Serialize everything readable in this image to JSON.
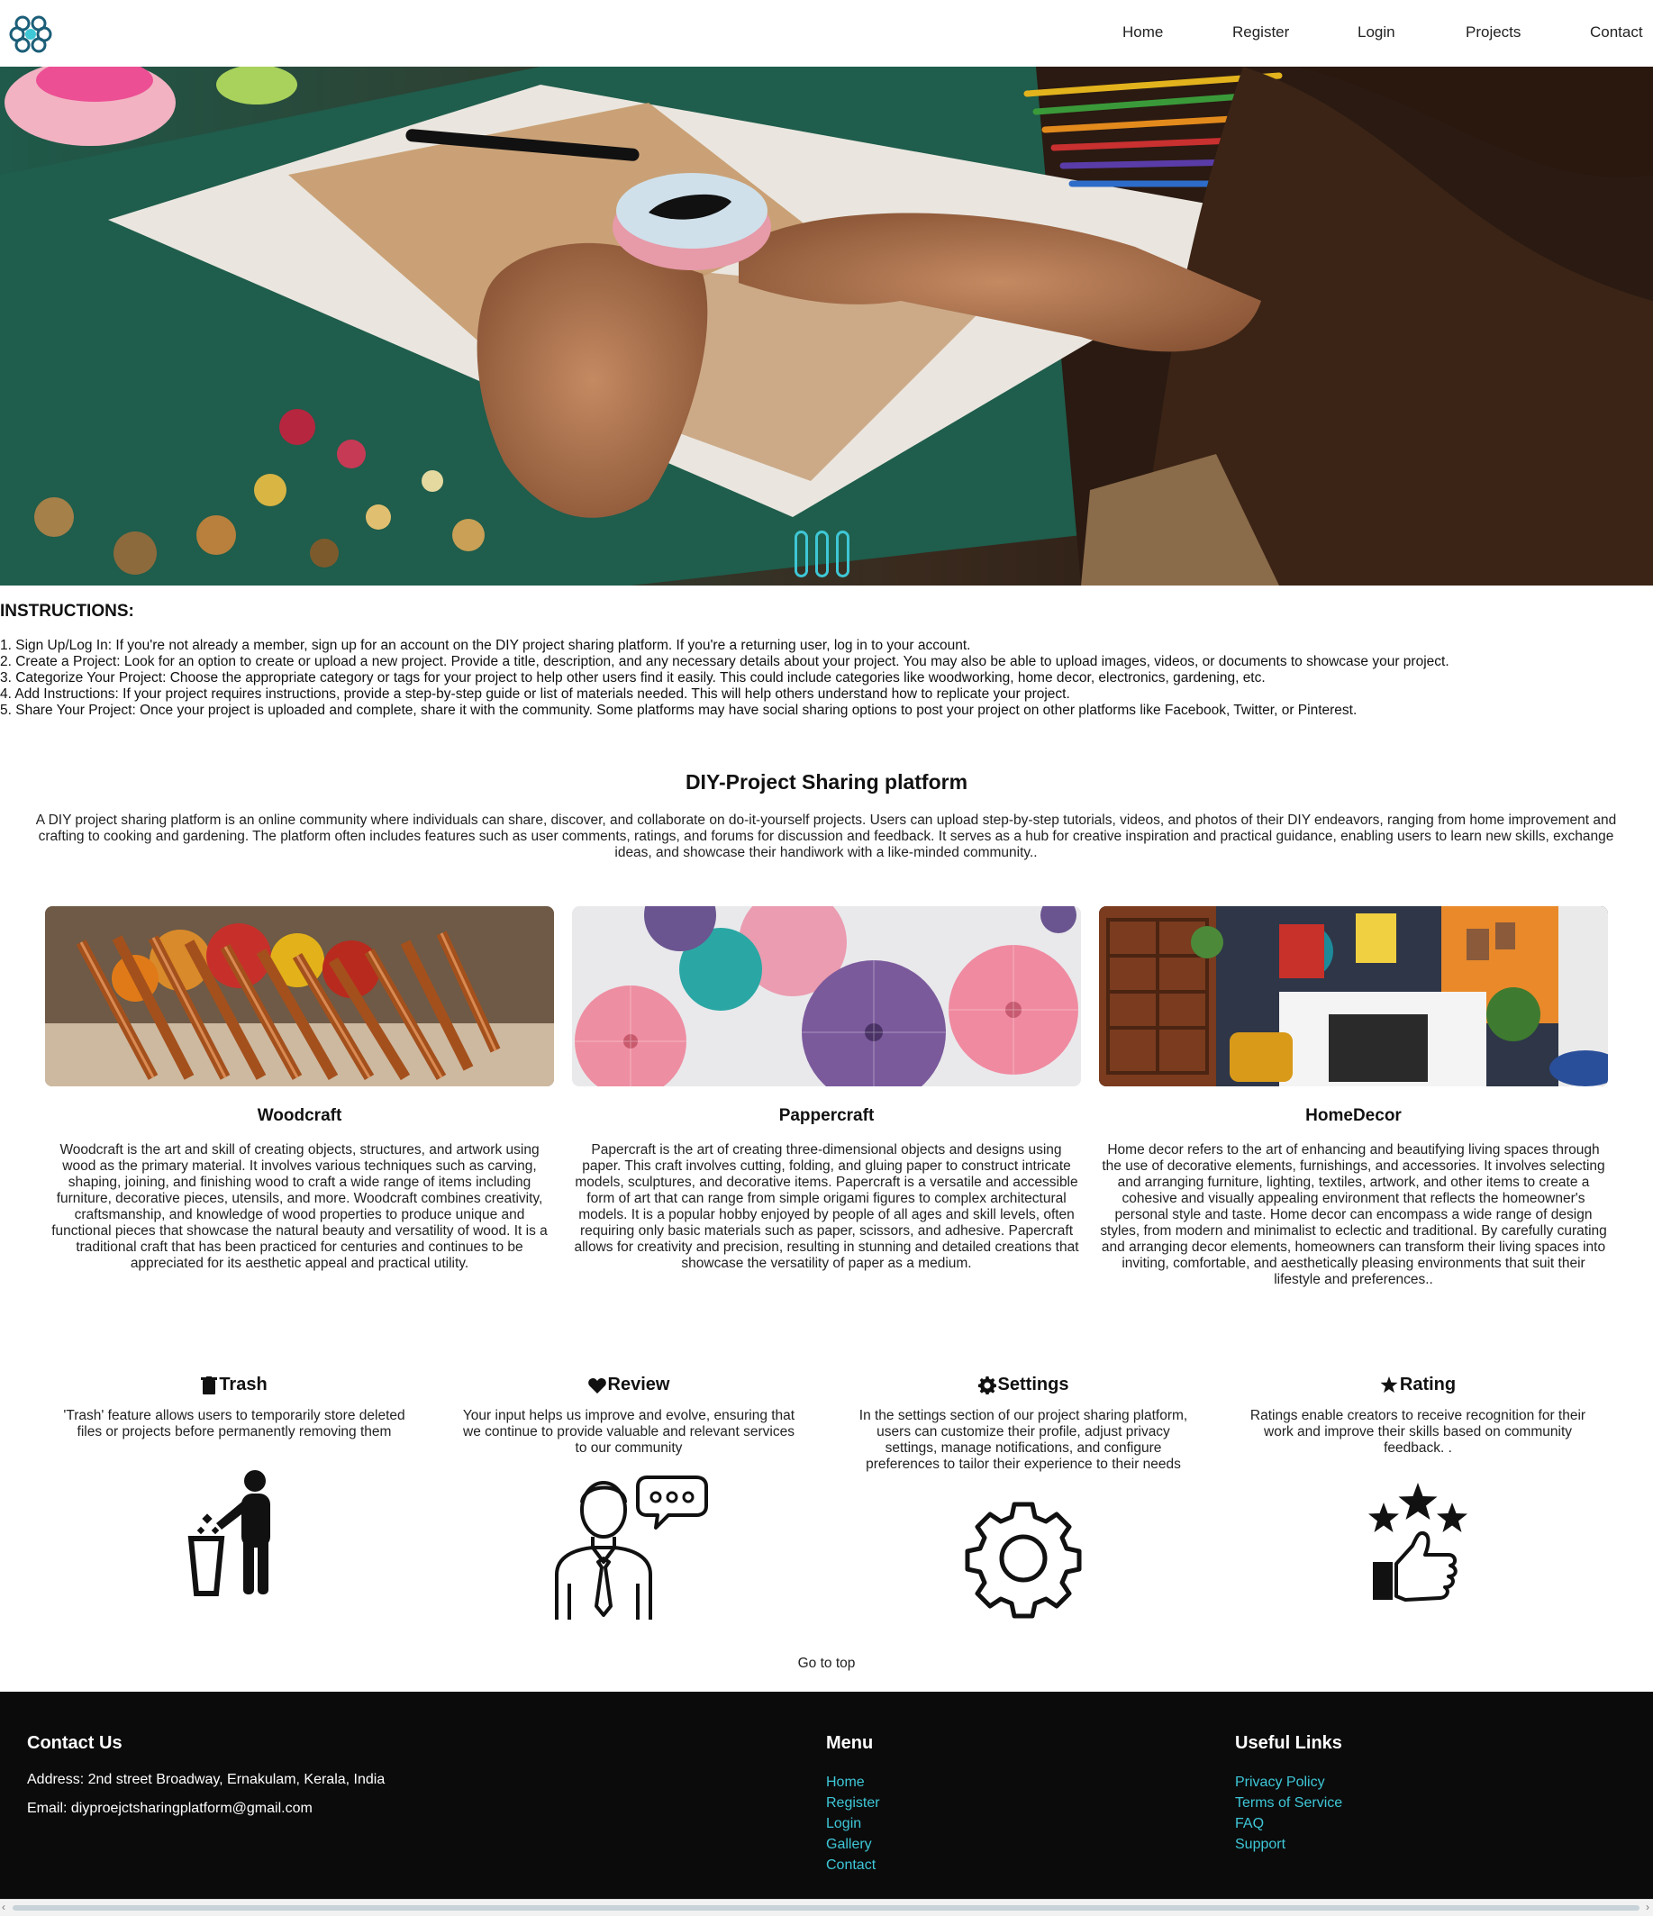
{
  "nav": {
    "items": [
      "Home",
      "Register",
      "Login",
      "Projects",
      "Contact"
    ],
    "logo_icon": "molecule-logo-icon"
  },
  "hero": {
    "slides": 3,
    "active_slide": 1,
    "accent": "#3ec7d6"
  },
  "instructions": {
    "title": "INSTRUCTIONS:",
    "items": [
      "1. Sign Up/Log In: If you're not already a member, sign up for an account on the DIY project sharing platform. If you're a returning user, log in to your account.",
      "2. Create a Project: Look for an option to create or upload a new project. Provide a title, description, and any necessary details about your project. You may also be able to upload images, videos, or documents to showcase your project.",
      "3. Categorize Your Project: Choose the appropriate category or tags for your project to help other users find it easily. This could include categories like woodworking, home decor, electronics, gardening, etc.",
      "4. Add Instructions: If your project requires instructions, provide a step-by-step guide or list of materials needed. This will help others understand how to replicate your project.",
      "5. Share Your Project: Once your project is uploaded and complete, share it with the community. Some platforms may have social sharing options to post your project on other platforms like Facebook, Twitter, or Pinterest."
    ]
  },
  "about": {
    "title": "DIY-Project Sharing platform",
    "text": "A DIY project sharing platform is an online community where individuals can share, discover, and collaborate on do-it-yourself projects. Users can upload step-by-step tutorials, videos, and photos of their DIY endeavors, ranging from home improvement and crafting to cooking and gardening. The platform often includes features such as user comments, ratings, and forums for discussion and feedback. It serves as a hub for creative inspiration and practical guidance, enabling users to learn new skills, exchange ideas, and showcase their handiwork with a like-minded community.."
  },
  "categories": [
    {
      "title": "Woodcraft",
      "text": "Woodcraft is the art and skill of creating objects, structures, and artwork using wood as the primary material. It involves various techniques such as carving, shaping, joining, and finishing wood to craft a wide range of items including furniture, decorative pieces, utensils, and more. Woodcraft combines creativity, craftsmanship, and knowledge of wood properties to produce unique and functional pieces that showcase the natural beauty and versatility of wood. It is a traditional craft that has been practiced for centuries and continues to be appreciated for its aesthetic appeal and practical utility."
    },
    {
      "title": "Pappercraft",
      "text": "Papercraft is the art of creating three-dimensional objects and designs using paper. This craft involves cutting, folding, and gluing paper to construct intricate models, sculptures, and decorative items. Papercraft is a versatile and accessible form of art that can range from simple origami figures to complex architectural models. It is a popular hobby enjoyed by people of all ages and skill levels, often requiring only basic materials such as paper, scissors, and adhesive. Papercraft allows for creativity and precision, resulting in stunning and detailed creations that showcase the versatility of paper as a medium."
    },
    {
      "title": "HomeDecor",
      "text": "Home decor refers to the art of enhancing and beautifying living spaces through the use of decorative elements, furnishings, and accessories. It involves selecting and arranging furniture, lighting, textiles, artwork, and other items to create a cohesive and visually appealing environment that reflects the homeowner's personal style and taste. Home decor can encompass a wide range of design styles, from modern and minimalist to eclectic and traditional. By carefully curating and arranging decor elements, homeowners can transform their living spaces into inviting, comfortable, and aesthetically pleasing environments that suit their lifestyle and preferences.."
    }
  ],
  "features": [
    {
      "title": "Trash",
      "icon": "trash-icon",
      "text": "'Trash' feature allows users to temporarily store deleted files or projects before permanently removing them"
    },
    {
      "title": "Review",
      "icon": "heart-icon",
      "text": "Your input helps us improve and evolve, ensuring that we continue to provide valuable and relevant services to our community"
    },
    {
      "title": "Settings",
      "icon": "gear-icon",
      "text": "In the settings section of our project sharing platform, users can customize their profile, adjust privacy settings, manage notifications, and configure preferences to tailor their experience to their needs"
    },
    {
      "title": "Rating",
      "icon": "star-icon",
      "text": "Ratings enable creators to receive recognition for their work and improve their skills based on community feedback. ."
    }
  ],
  "goto_top": "Go to top",
  "footer": {
    "contact": {
      "title": "Contact Us",
      "address": "Address: 2nd street Broadway, Ernakulam, Kerala, India",
      "email": "Email: diyproejctsharingplatform@gmail.com"
    },
    "menu": {
      "title": "Menu",
      "links": [
        "Home",
        "Register",
        "Login",
        "Gallery",
        "Contact"
      ]
    },
    "useful": {
      "title": "Useful Links",
      "links": [
        "Privacy Policy",
        "Terms of Service",
        "FAQ",
        "Support"
      ]
    },
    "link_color": "#3ec7d6",
    "background": "#0b0b0c"
  }
}
